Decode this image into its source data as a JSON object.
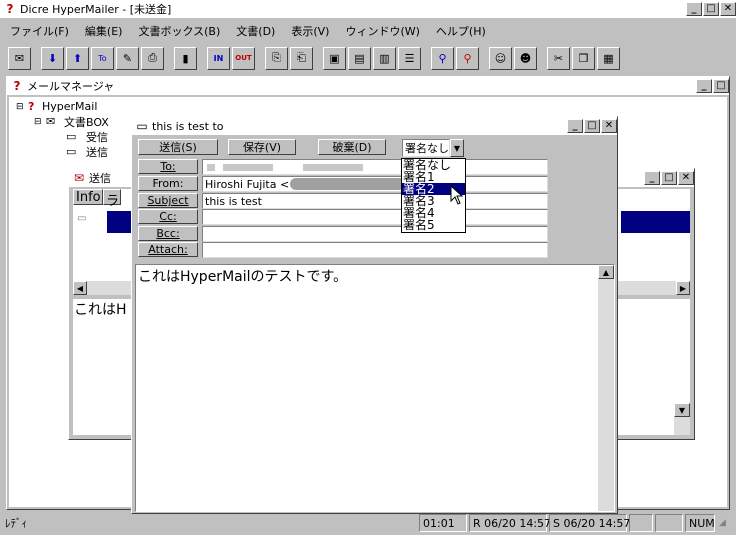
{
  "app": {
    "title": "Dicre HyperMailer - [未送金]"
  },
  "menu": [
    "ファイル(F)",
    "編集(E)",
    "文書ボックス(B)",
    "文書(D)",
    "表示(V)",
    "ウィンドウ(W)",
    "ヘルプ(H)"
  ],
  "toolbar": {
    "in_label": "IN",
    "out_label": "OUT",
    "to_label": "To"
  },
  "manager": {
    "title": "メールマネージャ",
    "tree": {
      "root": "HyperMail",
      "box": "文書BOX",
      "inbox": "受信",
      "outbox": "送信"
    }
  },
  "outbox_window": {
    "title": "送信",
    "col_info": "Info",
    "col_ra": "ラ",
    "preview": "これはH"
  },
  "compose": {
    "title": "this is test to",
    "send": "送信(S)",
    "save": "保存(V)",
    "discard": "破棄(D)",
    "sig_selected": "署名なし",
    "sig_options": [
      "署名なし",
      "署名1",
      "署名2",
      "署名3",
      "署名4",
      "署名5"
    ],
    "sig_highlight_index": 2,
    "labels": {
      "to": "To:",
      "from": "From:",
      "subject": "Subject",
      "cc": "Cc:",
      "bcc": "Bcc:",
      "attach": "Attach:"
    },
    "from_value": "Hiroshi Fujita <",
    "subject_value": "this is test",
    "body": "これはHyperMailのテストです。"
  },
  "status": {
    "ready": "ﾚﾃﾞｨ",
    "time": "01:01",
    "received": "R 06/20 14:57",
    "sent": "S 06/20 14:57",
    "num": "NUM"
  },
  "colors": {
    "titlebar": "#000080",
    "face": "#c0c0c0",
    "highlight": "#000080"
  }
}
